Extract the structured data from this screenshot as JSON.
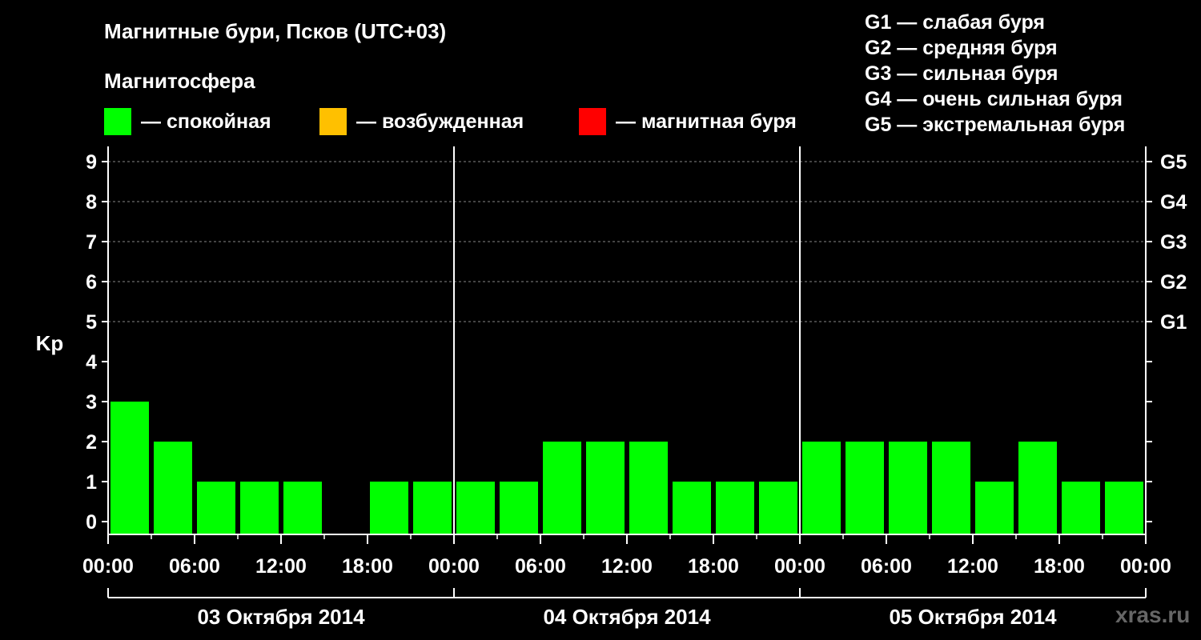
{
  "chart_data": {
    "type": "bar",
    "title": "Магнитные бури, Псков (UTC+03)",
    "subtitle": "Магнитосфера",
    "ylabel": "Kp",
    "ylim": [
      0,
      9
    ],
    "yticks": [
      "0",
      "1",
      "2",
      "3",
      "4",
      "5",
      "6",
      "7",
      "8",
      "9"
    ],
    "right_axis_labels": [
      {
        "kp": 5,
        "label": "G1"
      },
      {
        "kp": 6,
        "label": "G2"
      },
      {
        "kp": 7,
        "label": "G3"
      },
      {
        "kp": 8,
        "label": "G4"
      },
      {
        "kp": 9,
        "label": "G5"
      }
    ],
    "x_tick_labels": [
      "00:00",
      "06:00",
      "12:00",
      "18:00",
      "00:00",
      "06:00",
      "12:00",
      "18:00",
      "00:00",
      "06:00",
      "12:00",
      "18:00",
      "00:00"
    ],
    "days": [
      "03 Октября 2014",
      "04 Октября 2014",
      "05 Октября 2014"
    ],
    "interval_hours": 3,
    "values": [
      3,
      2,
      1,
      1,
      1,
      0,
      1,
      1,
      1,
      1,
      2,
      2,
      2,
      1,
      1,
      1,
      2,
      2,
      2,
      2,
      1,
      2,
      1,
      1
    ],
    "bar_color": "#00FF00",
    "grid": "dashed at Kp 5-9",
    "legend": [
      {
        "label": "— спокойная",
        "color": "#00FF00"
      },
      {
        "label": "— возбужденная",
        "color": "#FFC000"
      },
      {
        "label": "— магнитная буря",
        "color": "#FF0000"
      }
    ],
    "g_scale": [
      "G1 — слабая буря",
      "G2 — средняя буря",
      "G3 — сильная буря",
      "G4 — очень сильная буря",
      "G5 — экстремальная буря"
    ]
  },
  "watermark": "xras.ru"
}
